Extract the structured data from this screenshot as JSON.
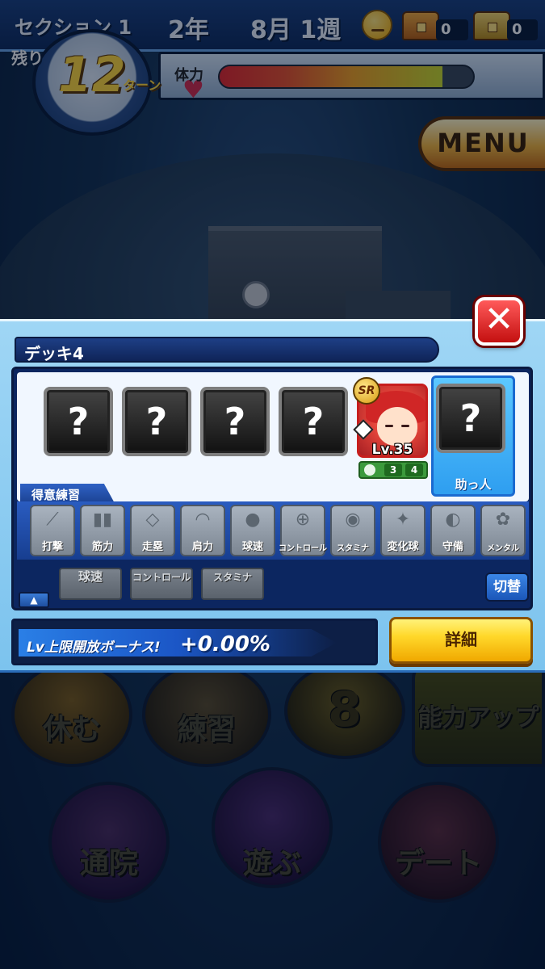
{
  "hud": {
    "section": "セクション 1",
    "year": "2年",
    "week": "8月 1週",
    "chest1_count": "0",
    "chest2_count": "0",
    "remaining_label": "残り",
    "turns": "12",
    "turns_suffix": "ターン",
    "stamina_label": "体力",
    "stamina_level": 0.88,
    "menu_label": "MENU"
  },
  "background_buttons": {
    "rest": "休む",
    "practice": "練習",
    "eight": "8",
    "ability_up": "能力アップ",
    "hospital": "通院",
    "play": "遊ぶ",
    "date": "デート"
  },
  "deck_panel": {
    "close_symbol": "✕",
    "title": "デッキ4",
    "empty_slots": [
      "?",
      "?",
      "?",
      "?"
    ],
    "character": {
      "rarity": "SR",
      "level": "Lv.35",
      "stat_a": "3",
      "stat_b": "4"
    },
    "helper": {
      "slot": "?",
      "label": "助っ人"
    },
    "specialty_header": "得意練習",
    "practices": [
      "打撃",
      "筋力",
      "走塁",
      "肩力",
      "球速",
      "コントロール",
      "スタミナ",
      "変化球",
      "守備",
      "メンタル"
    ],
    "skills": [
      "球速",
      "コントロール",
      "スタミナ"
    ],
    "switch_label": "切替",
    "bonus_label": "Lv上限開放ボーナス!",
    "bonus_value": "+0.00%",
    "detail_label": "詳細"
  },
  "colors": {
    "panel_bg": "#9fd6f5",
    "deck_navy": "#0c2660",
    "helper_blue": "#2e9ef0",
    "detail_yellow": "#ffd82a",
    "close_red": "#c41010"
  }
}
